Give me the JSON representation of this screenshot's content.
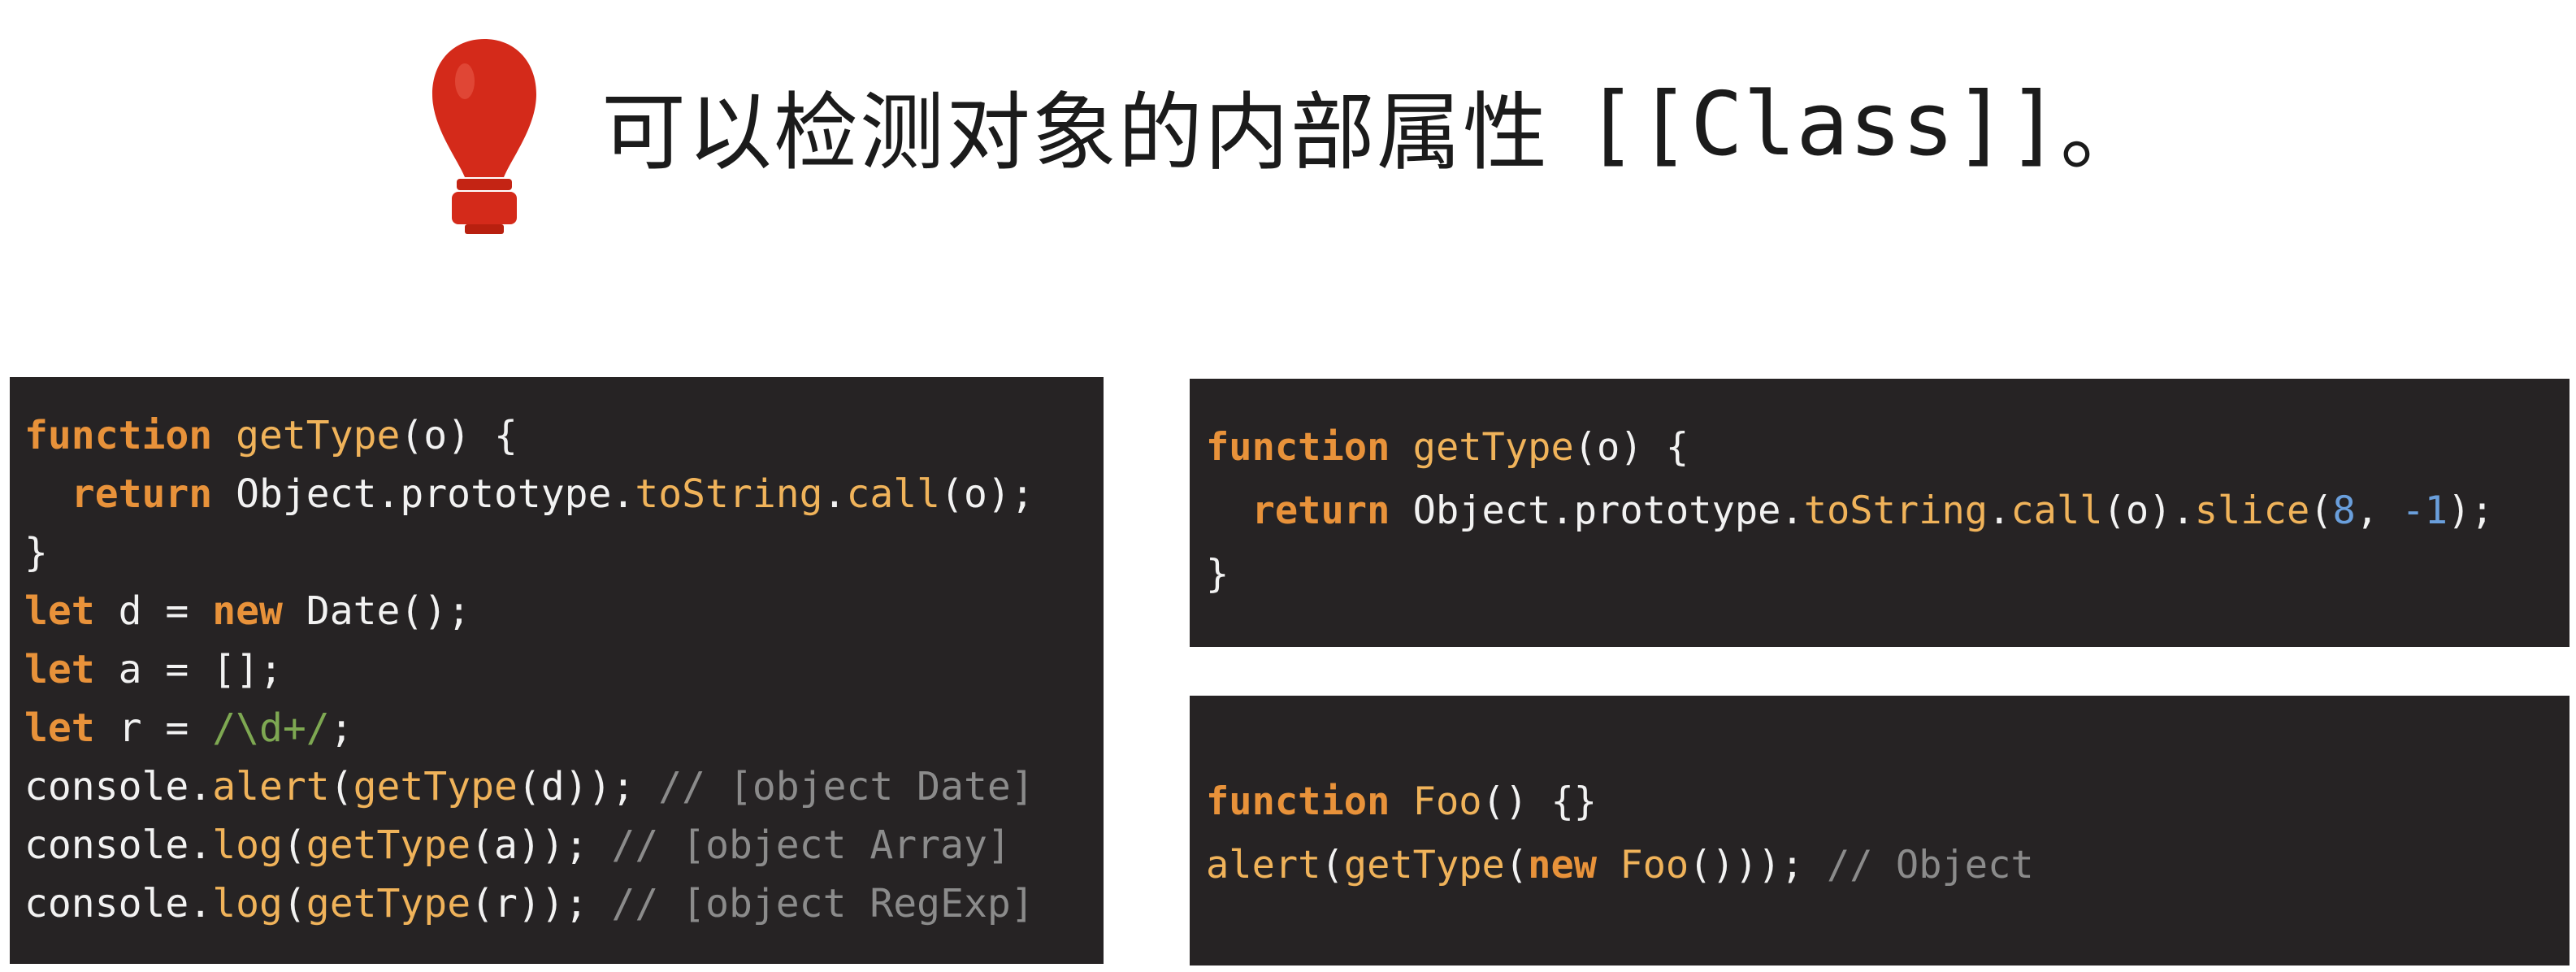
{
  "heading": {
    "text_cn": "可以检测对象的内部属性",
    "text_code": "[[Class]]",
    "period": "。",
    "icon": "lightbulb-icon",
    "icon_color": "#d42a1a"
  },
  "colors": {
    "panel_bg": "#262324",
    "keyword": "#e8923a",
    "function": "#f0b35a",
    "number": "#6a9fdc",
    "regex": "#7ea852",
    "comment": "#8b8b8b",
    "text": "#f2f2f2"
  },
  "code_left": [
    [
      [
        "kw",
        "function"
      ],
      [
        "tx",
        " "
      ],
      [
        "fn",
        "getType"
      ],
      [
        "tx",
        "(o) {"
      ]
    ],
    [
      [
        "tx",
        "  "
      ],
      [
        "kw",
        "return"
      ],
      [
        "tx",
        " Object.prototype."
      ],
      [
        "fn",
        "toString"
      ],
      [
        "tx",
        "."
      ],
      [
        "fn",
        "call"
      ],
      [
        "tx",
        "(o);"
      ]
    ],
    [
      [
        "tx",
        "}"
      ]
    ],
    [
      [
        "kw",
        "let"
      ],
      [
        "tx",
        " d = "
      ],
      [
        "kw",
        "new"
      ],
      [
        "tx",
        " Date();"
      ]
    ],
    [
      [
        "kw",
        "let"
      ],
      [
        "tx",
        " a = [];"
      ]
    ],
    [
      [
        "kw",
        "let"
      ],
      [
        "tx",
        " r = "
      ],
      [
        "re",
        "/\\d+/"
      ],
      [
        "tx",
        ";"
      ]
    ],
    [
      [
        "tx",
        "console."
      ],
      [
        "fn",
        "alert"
      ],
      [
        "tx",
        "("
      ],
      [
        "fn",
        "getType"
      ],
      [
        "tx",
        "(d)); "
      ],
      [
        "cm",
        "// [object Date]"
      ]
    ],
    [
      [
        "tx",
        "console."
      ],
      [
        "fn",
        "log"
      ],
      [
        "tx",
        "("
      ],
      [
        "fn",
        "getType"
      ],
      [
        "tx",
        "(a)); "
      ],
      [
        "cm",
        "// [object Array]"
      ]
    ],
    [
      [
        "tx",
        "console."
      ],
      [
        "fn",
        "log"
      ],
      [
        "tx",
        "("
      ],
      [
        "fn",
        "getType"
      ],
      [
        "tx",
        "(r)); "
      ],
      [
        "cm",
        "// [object RegExp]"
      ]
    ]
  ],
  "code_right_top": [
    [
      [
        "kw",
        "function"
      ],
      [
        "tx",
        " "
      ],
      [
        "fn",
        "getType"
      ],
      [
        "tx",
        "(o) {"
      ]
    ],
    [
      [
        "tx",
        "  "
      ],
      [
        "kw",
        "return"
      ],
      [
        "tx",
        " Object.prototype."
      ],
      [
        "fn",
        "toString"
      ],
      [
        "tx",
        "."
      ],
      [
        "fn",
        "call"
      ],
      [
        "tx",
        "(o)."
      ],
      [
        "fn",
        "slice"
      ],
      [
        "tx",
        "("
      ],
      [
        "num",
        "8"
      ],
      [
        "tx",
        ", "
      ],
      [
        "num",
        "-1"
      ],
      [
        "tx",
        ");"
      ]
    ],
    [
      [
        "tx",
        "}"
      ]
    ]
  ],
  "code_right_bottom": [
    [
      [
        "kw",
        "function"
      ],
      [
        "tx",
        " "
      ],
      [
        "fn",
        "Foo"
      ],
      [
        "tx",
        "() {}"
      ]
    ],
    [
      [
        "fn",
        "alert"
      ],
      [
        "tx",
        "("
      ],
      [
        "fn",
        "getType"
      ],
      [
        "tx",
        "("
      ],
      [
        "kw",
        "new"
      ],
      [
        "tx",
        " "
      ],
      [
        "fn",
        "Foo"
      ],
      [
        "tx",
        "())); "
      ],
      [
        "cm",
        "// Object"
      ]
    ]
  ]
}
